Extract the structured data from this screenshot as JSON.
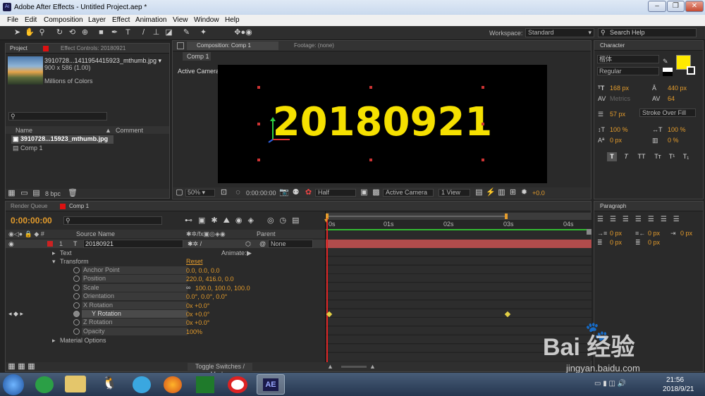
{
  "window": {
    "title": "Adobe After Effects - Untitled Project.aep *",
    "app_icon": "Ai"
  },
  "menu": [
    "File",
    "Edit",
    "Composition",
    "Layer",
    "Effect",
    "Animation",
    "View",
    "Window",
    "Help"
  ],
  "toolbar": {
    "workspace_label": "Workspace:",
    "workspace_value": "Standard",
    "search_placeholder": "Search Help"
  },
  "project": {
    "tab_project": "Project",
    "tab_effects": "Effect Controls: 20180921",
    "thumb_name": "3910728...1411954415923_mthumb.jpg ▾",
    "thumb_dims": "900 x 586 (1.00)",
    "thumb_colors": "Millions of Colors",
    "col_name": "Name",
    "col_comment": "Comment",
    "items": [
      "3910728...15923_mthumb.jpg",
      "Comp 1"
    ],
    "bpc": "8 bpc"
  },
  "composition": {
    "tab": "Composition: Comp 1",
    "footage_tab": "Footage: (none)",
    "subtab": "Comp 1",
    "camera_label": "Active Camera",
    "text": "20180921",
    "text_color": "#f5e000",
    "zoom": "50%",
    "timecode": "0:00:00:00",
    "resolution": "Half",
    "camera_select": "Active Camera",
    "view_select": "1 View",
    "exposure": "+0.0"
  },
  "character": {
    "tab": "Character",
    "font": "楷体",
    "style": "Regular",
    "size": "168 px",
    "leading": "440 px",
    "kerning": "Metrics",
    "tracking": "64",
    "stroke": "57 px",
    "stroke_mode": "Stroke Over Fill",
    "vscale": "100 %",
    "hscale": "100 %",
    "baseline": "0 px",
    "tsume": "0 %",
    "fill_color": "#ffea00",
    "format_buttons": [
      "T",
      "T",
      "TT",
      "Tт",
      "T¹",
      "T₁"
    ]
  },
  "paragraph": {
    "tab": "Paragraph",
    "vals": [
      "0 px",
      "0 px",
      "0 px",
      "0 px",
      "0 px"
    ]
  },
  "timeline": {
    "tab_render": "Render Queue",
    "tab_comp": "Comp 1",
    "timecode": "0:00:00:00",
    "col_source": "Source Name",
    "col_parent": "Parent",
    "layer_num": "1",
    "layer_name": "20180921",
    "parent_value": "None",
    "ruler": [
      "0s",
      "01s",
      "02s",
      "03s",
      "04s"
    ],
    "text_group": "Text",
    "animate_label": "Animate:",
    "transform_group": "Transform",
    "reset_label": "Reset",
    "material_group": "Material Options",
    "toggle_label": "Toggle Switches / Modes",
    "properties": [
      {
        "name": "Anchor Point",
        "value": "0.0, 0.0, 0.0"
      },
      {
        "name": "Position",
        "value": "220.0, 416.0, 0.0"
      },
      {
        "name": "Scale",
        "value": "100.0, 100.0, 100.0"
      },
      {
        "name": "Orientation",
        "value": "0.0°, 0.0°, 0.0°"
      },
      {
        "name": "X Rotation",
        "value": "0x +0.0°"
      },
      {
        "name": "Y Rotation",
        "value": "0x +0.0°"
      },
      {
        "name": "Z Rotation",
        "value": "0x +0.0°"
      },
      {
        "name": "Opacity",
        "value": "100%"
      }
    ]
  },
  "taskbar": {
    "time": "21:56",
    "date": "2018/9/21",
    "ae_label": "AE"
  },
  "watermark": {
    "brand": "Bai  经验",
    "url": "jingyan.baidu.com"
  }
}
